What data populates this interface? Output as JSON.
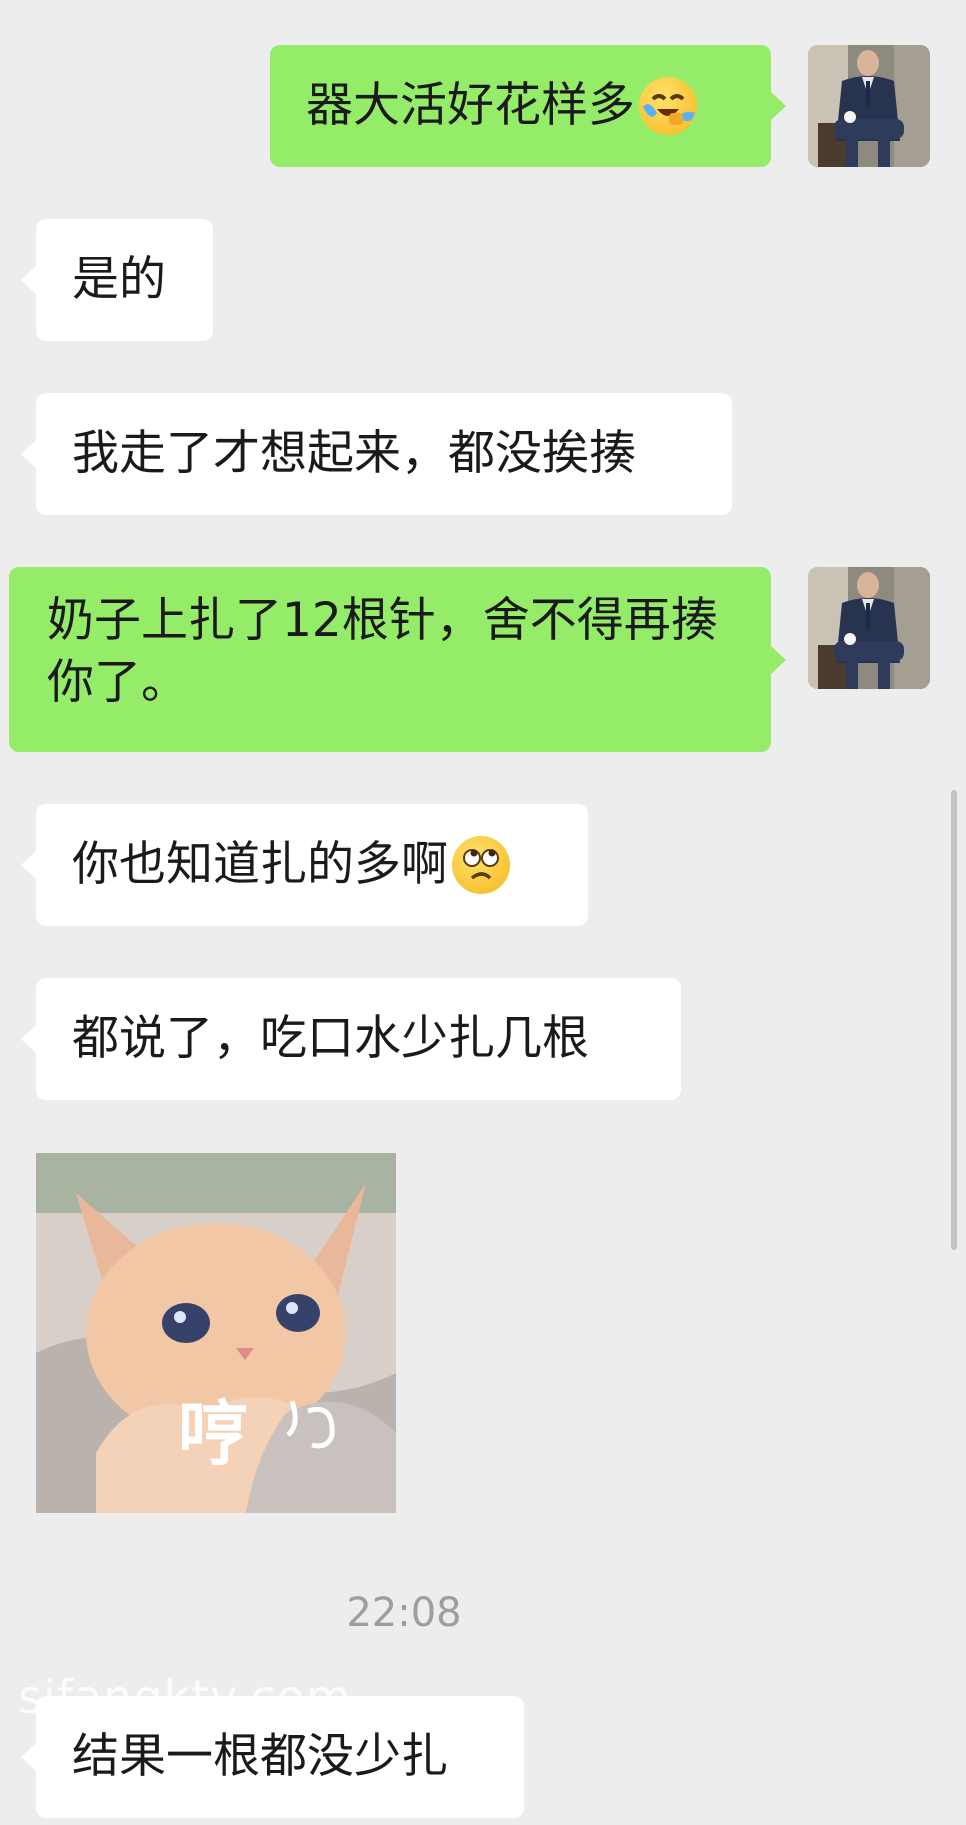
{
  "messages": {
    "m1": {
      "text": "器大活好花样多",
      "sender": "self",
      "emoji": "laughing-crying-face-icon"
    },
    "m2": {
      "text": "是的",
      "sender": "other"
    },
    "m3": {
      "text": "我走了才想起来，都没挨揍",
      "sender": "other"
    },
    "m4": {
      "text": "奶子上扎了12根针，舍不得再揍你了。",
      "sender": "self"
    },
    "m5": {
      "text": "你也知道扎的多啊",
      "sender": "other",
      "emoji": "eye-roll-face-icon"
    },
    "m6": {
      "text": "都说了，吃口水少扎几根",
      "sender": "other"
    },
    "m7": {
      "sticker_text": "哼",
      "sender": "other",
      "sticker": "sulking-cat-sticker"
    },
    "m8": {
      "text": "结果一根都没少扎",
      "sender": "other"
    }
  },
  "timestamp": "22:08",
  "watermark": "sifangktv.com",
  "colors": {
    "background": "#ededed",
    "self_bubble": "#95ec69",
    "other_bubble": "#ffffff",
    "timestamp": "#9e9e9e"
  }
}
